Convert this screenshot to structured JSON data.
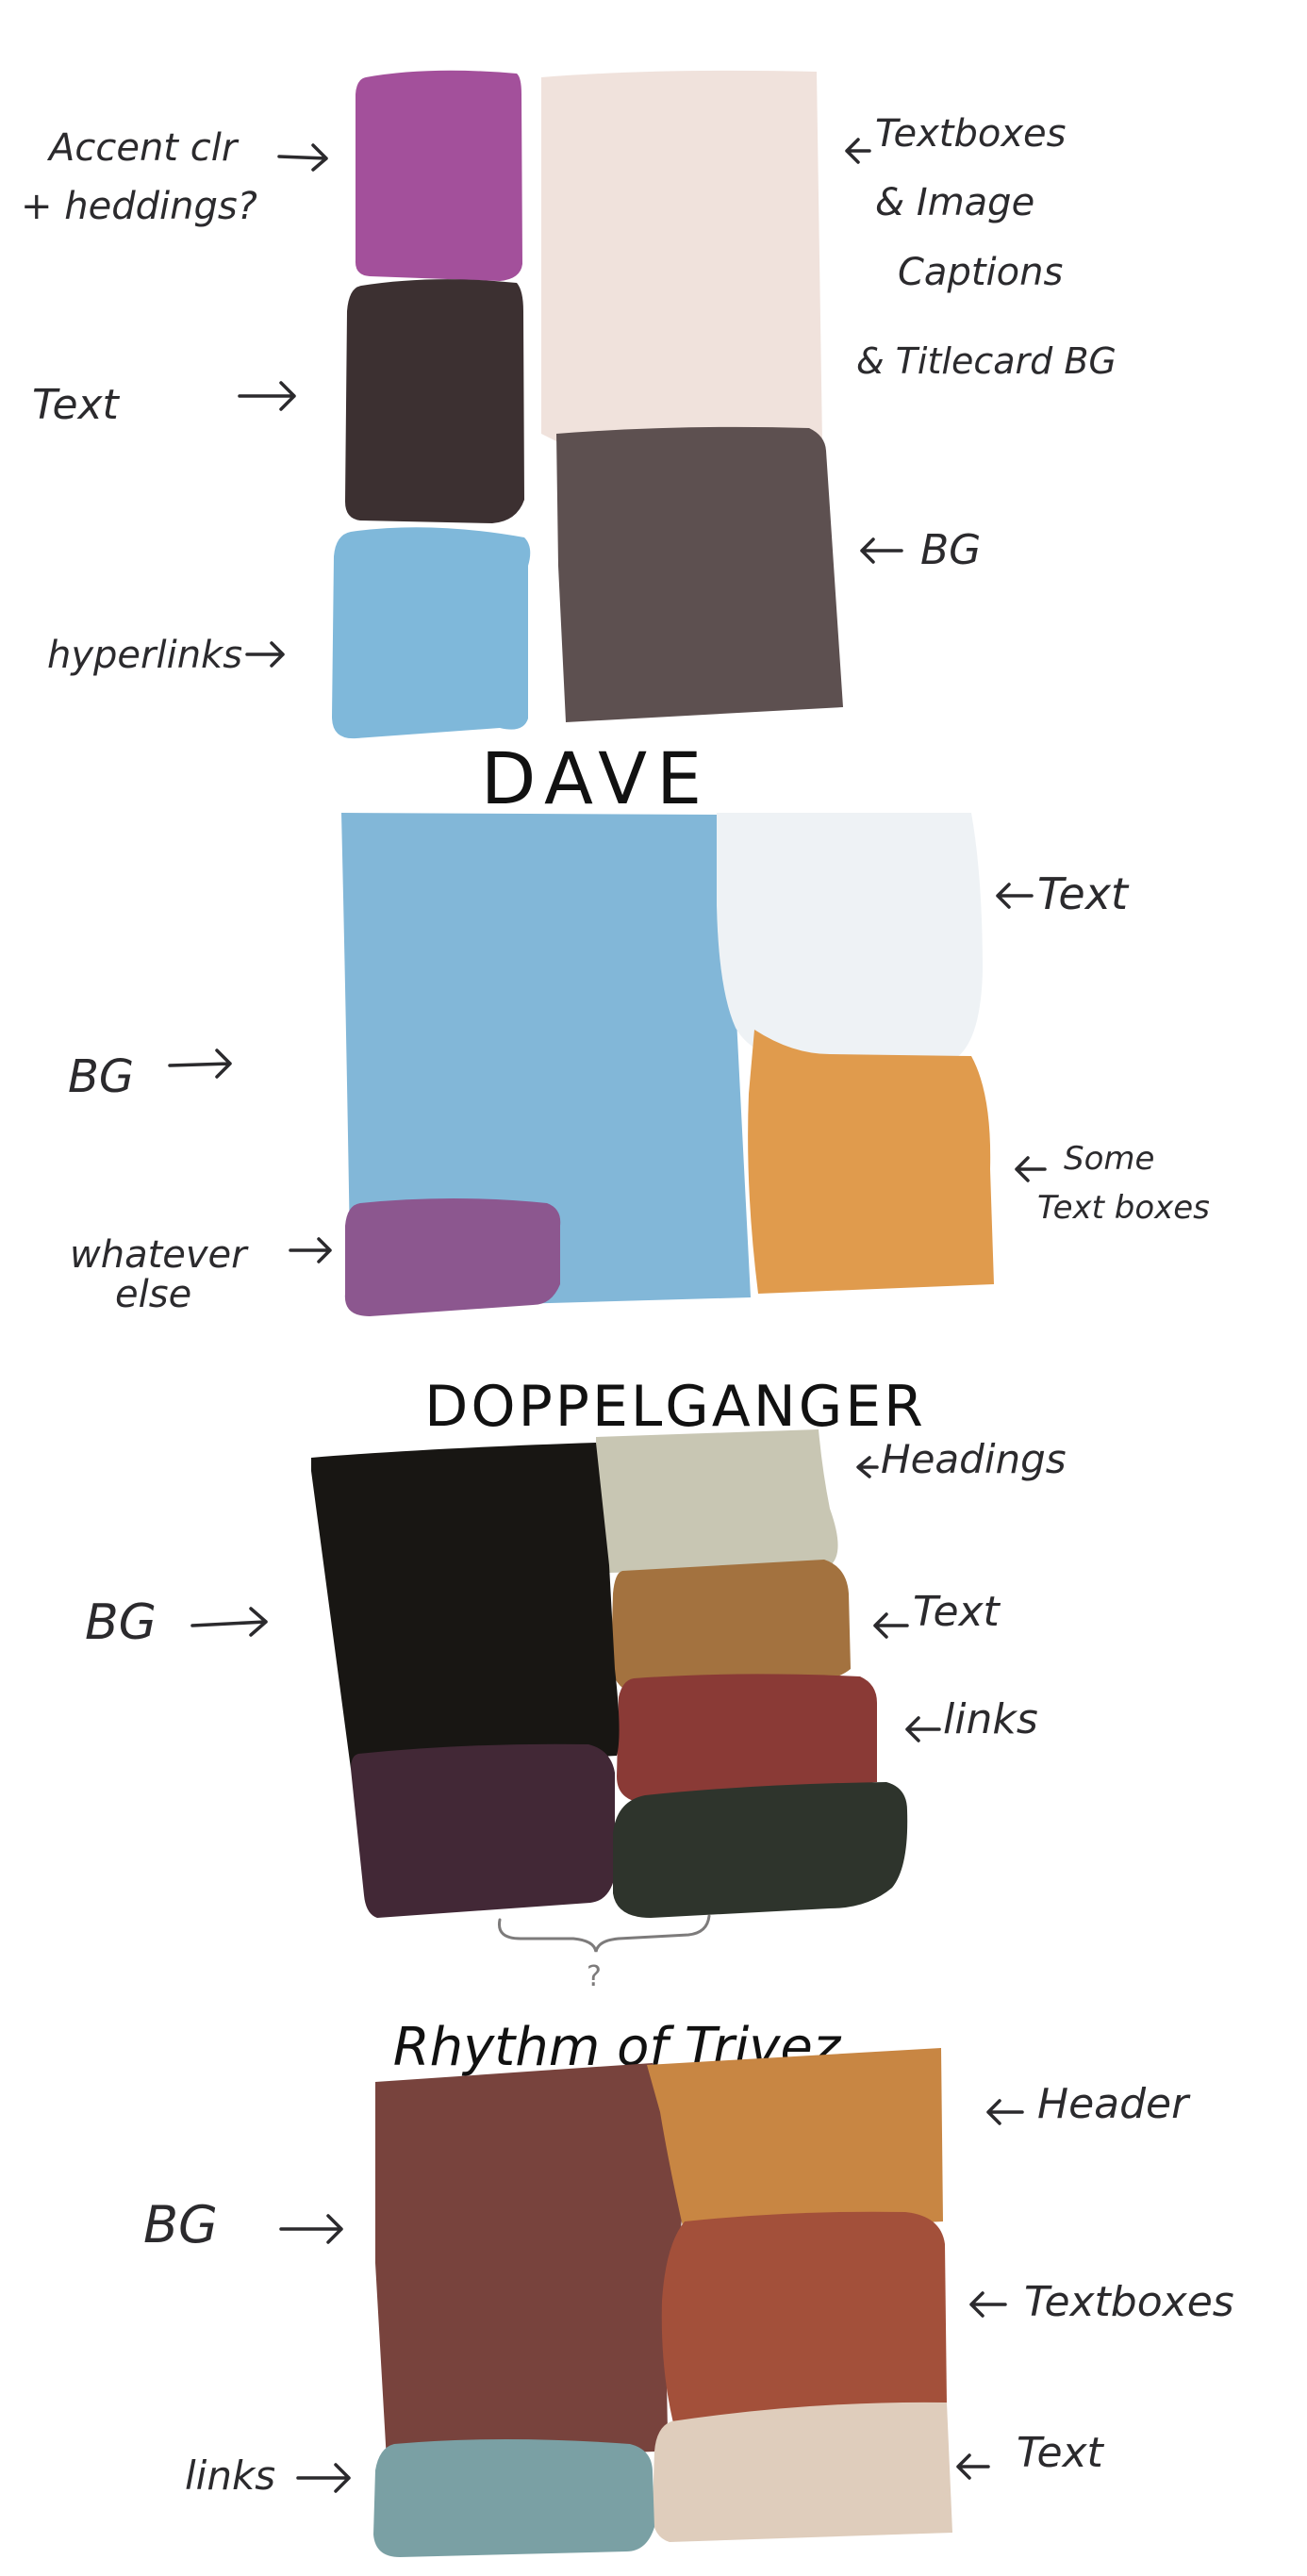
{
  "palette1": {
    "swatches": {
      "accent": "#a3509b",
      "text": "#3c3031",
      "links": "#7fb8da",
      "textboxes": "#f0e2dc",
      "bg": "#5d5050"
    },
    "labels": {
      "accent_line1": "Accent clr",
      "accent_line2": "+ heddings?",
      "text": "Text",
      "links": "hyperlinks",
      "textboxes_line1": "Textboxes",
      "textboxes_line2": "& Image",
      "textboxes_line3": "Captions",
      "textboxes_line4": "& Titlecard BG",
      "bg": "BG"
    }
  },
  "palette2": {
    "title": "DAVE",
    "swatches": {
      "bg": "#82b7d8",
      "text": "#eef2f5",
      "textboxes": "#e09b4d",
      "other": "#8c578f"
    },
    "labels": {
      "text": "Text",
      "textboxes_line1": "Some",
      "textboxes_line2": "Text boxes",
      "bg": "BG",
      "other_line1": "whatever",
      "other_line2": "else"
    }
  },
  "palette3": {
    "title": "DOPPELGANGER",
    "swatches": {
      "bg": "#181613",
      "headings": "#c8c6b3",
      "text": "#a3723f",
      "links": "#8a3a36",
      "purple": "#422836",
      "green": "#2e342c"
    },
    "labels": {
      "headings": "Headings",
      "text": "Text",
      "links": "links",
      "bg": "BG",
      "question": "?"
    }
  },
  "palette4": {
    "title": "Rhythm of Trivez",
    "swatches": {
      "bg": "#78433d",
      "header": "#c88643",
      "textboxes": "#a3503a",
      "text": "#dfcdbc",
      "links": "#7aa0a4"
    },
    "labels": {
      "header": "Header",
      "textboxes": "Textboxes",
      "text": "Text",
      "bg": "BG",
      "links": "links"
    }
  }
}
